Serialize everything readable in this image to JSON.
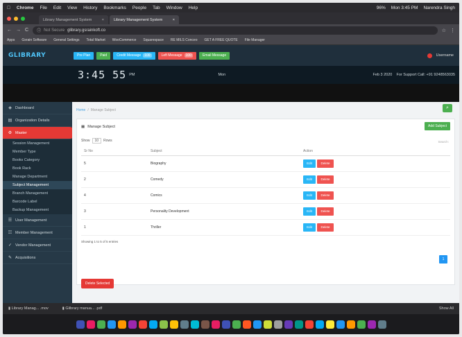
{
  "menubar": {
    "apple": "",
    "items": [
      "Chrome",
      "File",
      "Edit",
      "View",
      "History",
      "Bookmarks",
      "People",
      "Tab",
      "Window",
      "Help"
    ],
    "right": [
      "96%",
      "Mon 3:45 PM",
      "Narendra Singh"
    ]
  },
  "tabs": [
    {
      "label": "Library Management System",
      "active": false
    },
    {
      "label": "Library Management System",
      "active": true
    }
  ],
  "address": {
    "not_secure": "Not Secure",
    "url": "glibrary.gsrainkoft.co"
  },
  "bookmarks": [
    "Apps",
    "Gsrain Software",
    "General Settings",
    "Total Market",
    "WooCommerce",
    "Squarespace",
    "RE MILS Conceo",
    "GET A FREE QUOTE",
    "File Manager"
  ],
  "app": {
    "logo": "GLIBRARY",
    "header_buttons": [
      {
        "label": "Pre Plan",
        "color": "#29b6f6",
        "badge": ""
      },
      {
        "label": "Paid",
        "color": "#4caf50",
        "badge": ""
      },
      {
        "label": "Credit Message",
        "color": "#29b6f6",
        "badge": "100"
      },
      {
        "label": "Left Message",
        "color": "#ef5350",
        "badge": "100"
      },
      {
        "label": "Email Message",
        "color": "#4caf50",
        "badge": ""
      }
    ],
    "user": "Username"
  },
  "clockbar": {
    "time": "3:45 55",
    "ampm": "PM",
    "day": "Mon",
    "date": "Feb 3 2020",
    "support": "For Support Call: +91 9248563035"
  },
  "sidebar": {
    "items": [
      {
        "label": "Dashboard",
        "icon": "dashboard-icon"
      },
      {
        "label": "Organization Details",
        "icon": "organization-icon"
      },
      {
        "label": "Master",
        "icon": "gear-icon",
        "active": true
      }
    ],
    "submenu": [
      "Session Management",
      "Member Type",
      "Books Category",
      "Book Rack",
      "Manage Department",
      "Subject Management",
      "Branch Management",
      "Barcode Label",
      "Backup Management"
    ],
    "current_sub": 5,
    "items_after": [
      {
        "label": "User Management",
        "icon": "users-icon"
      },
      {
        "label": "Member Management",
        "icon": "member-icon"
      },
      {
        "label": "Vendor Management",
        "icon": "vendor-icon"
      },
      {
        "label": "Acquisitions",
        "icon": "acquisition-icon"
      }
    ]
  },
  "content": {
    "breadcrumb": {
      "home": "Home",
      "current": "Manage Subject"
    },
    "panel_title": "Manage Subject",
    "add_button": "Add Subject",
    "show": "Show",
    "entries_value": "10",
    "entries": "Rows",
    "search": "Search:",
    "columns": [
      "Sr No",
      "Subject",
      "Action"
    ],
    "rows": [
      {
        "sr": "5",
        "subject": "Biography"
      },
      {
        "sr": "2",
        "subject": "Comedy"
      },
      {
        "sr": "4",
        "subject": "Comics"
      },
      {
        "sr": "3",
        "subject": "Personality Development"
      },
      {
        "sr": "1",
        "subject": "Thriller"
      }
    ],
    "edit_label": "Edit",
    "delete_label": "Delete",
    "showing": "Showing 1 to 5 of 5 entries",
    "page": "1",
    "delete_selected": "Delete Selected"
  },
  "downloads": [
    {
      "label": "Library Manag... .mov"
    },
    {
      "label": "Glibrary manua... .pdf"
    }
  ],
  "show_all": "Show All",
  "dock_colors": [
    "#3f51b5",
    "#e91e63",
    "#4caf50",
    "#2196f3",
    "#ff9800",
    "#9c27b0",
    "#f44336",
    "#03a9f4",
    "#8bc34a",
    "#ffc107",
    "#607d8b",
    "#00bcd4",
    "#795548",
    "#e91e63",
    "#3f51b5",
    "#4caf50",
    "#ff5722",
    "#2196f3",
    "#cddc39",
    "#9e9e9e",
    "#673ab7",
    "#009688",
    "#f44336",
    "#03a9f4",
    "#ffeb3b",
    "#2196f3",
    "#ff9800",
    "#4caf50",
    "#9c27b0",
    "#607d8b"
  ]
}
